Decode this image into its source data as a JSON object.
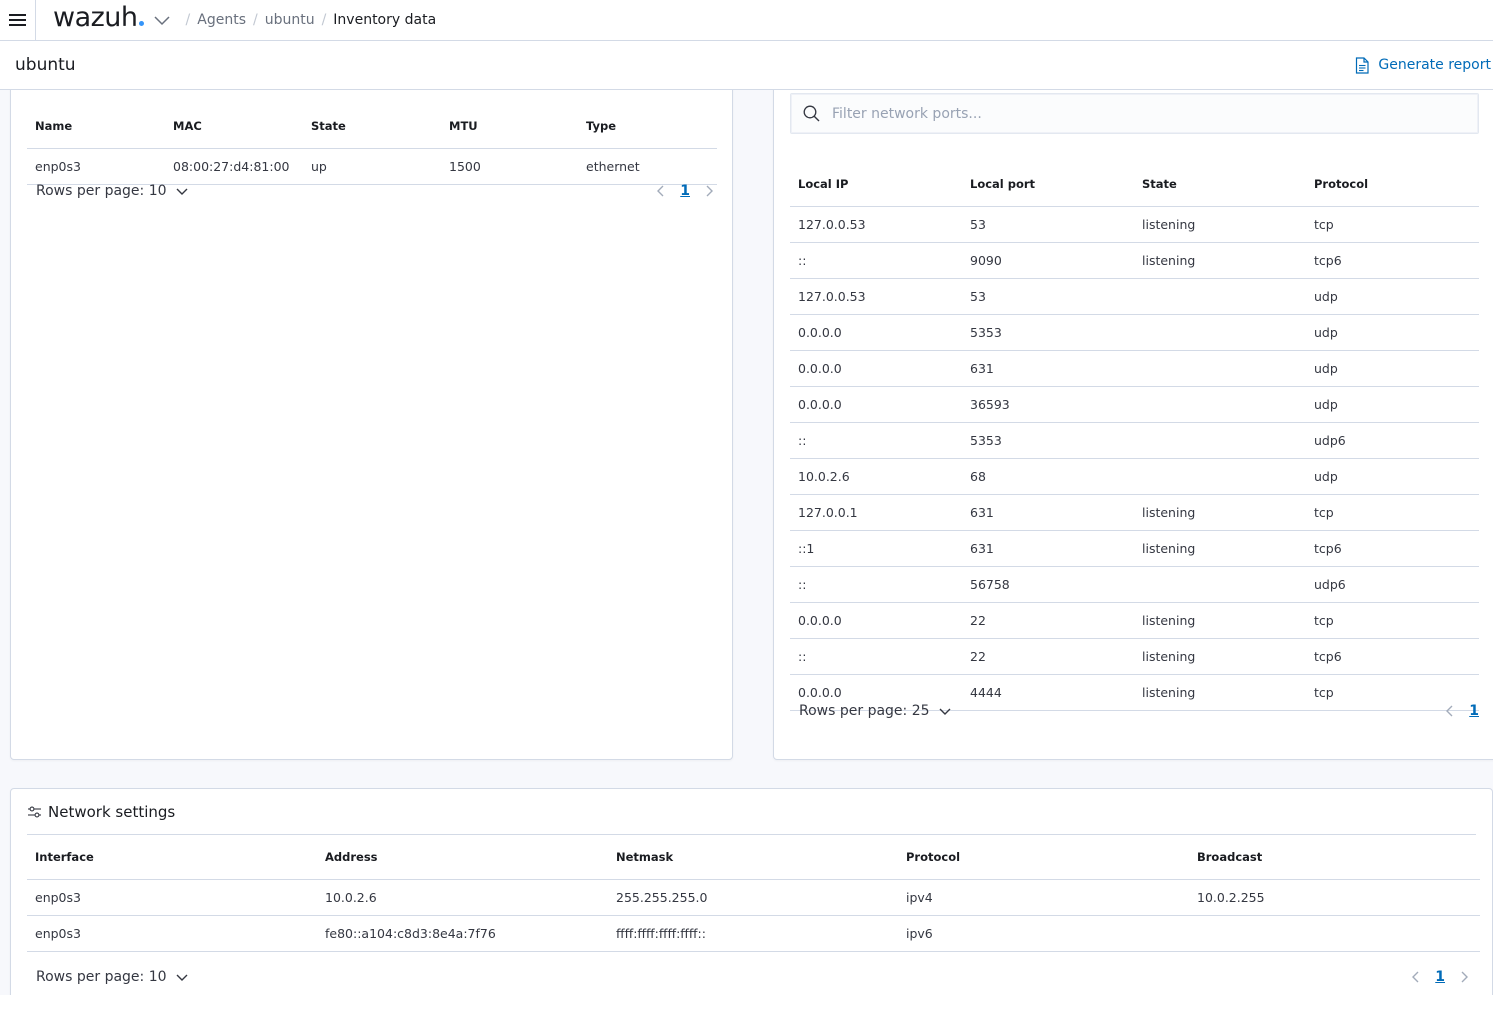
{
  "topbar": {
    "logo": "wazuh",
    "breadcrumbs": [
      {
        "label": "Agents"
      },
      {
        "label": "ubuntu"
      },
      {
        "label": "Inventory data"
      }
    ]
  },
  "header": {
    "title": "ubuntu",
    "generate_report": "Generate report"
  },
  "interfaces_table": {
    "columns": [
      "Name",
      "MAC",
      "State",
      "MTU",
      "Type"
    ],
    "rows": [
      [
        "enp0s3",
        "08:00:27:d4:81:00",
        "up",
        "1500",
        "ethernet"
      ]
    ],
    "rows_per_page": "Rows per page: 10",
    "page": "1"
  },
  "ports_table": {
    "search_placeholder": "Filter network ports...",
    "columns": [
      "Local IP",
      "Local port",
      "State",
      "Protocol"
    ],
    "rows": [
      [
        "127.0.0.53",
        "53",
        "listening",
        "tcp"
      ],
      [
        "::",
        "9090",
        "listening",
        "tcp6"
      ],
      [
        "127.0.0.53",
        "53",
        "",
        "udp"
      ],
      [
        "0.0.0.0",
        "5353",
        "",
        "udp"
      ],
      [
        "0.0.0.0",
        "631",
        "",
        "udp"
      ],
      [
        "0.0.0.0",
        "36593",
        "",
        "udp"
      ],
      [
        "::",
        "5353",
        "",
        "udp6"
      ],
      [
        "10.0.2.6",
        "68",
        "",
        "udp"
      ],
      [
        "127.0.0.1",
        "631",
        "listening",
        "tcp"
      ],
      [
        "::1",
        "631",
        "listening",
        "tcp6"
      ],
      [
        "::",
        "56758",
        "",
        "udp6"
      ],
      [
        "0.0.0.0",
        "22",
        "listening",
        "tcp"
      ],
      [
        "::",
        "22",
        "listening",
        "tcp6"
      ],
      [
        "0.0.0.0",
        "4444",
        "listening",
        "tcp"
      ]
    ],
    "rows_per_page": "Rows per page: 25",
    "page": "1"
  },
  "network_settings": {
    "title": "Network settings",
    "columns": [
      "Interface",
      "Address",
      "Netmask",
      "Protocol",
      "Broadcast"
    ],
    "rows": [
      [
        "enp0s3",
        "10.0.2.6",
        "255.255.255.0",
        "ipv4",
        "10.0.2.255"
      ],
      [
        "enp0s3",
        "fe80::a104:c8d3:8e4a:7f76",
        "ffff:ffff:ffff:ffff::",
        "ipv6",
        ""
      ]
    ],
    "rows_per_page": "Rows per page: 10",
    "page": "1"
  },
  "colors": {
    "link": "#006bb8",
    "border": "#d3dae6",
    "background": "#f7f8fc",
    "logo_dot": "#3595f9"
  }
}
